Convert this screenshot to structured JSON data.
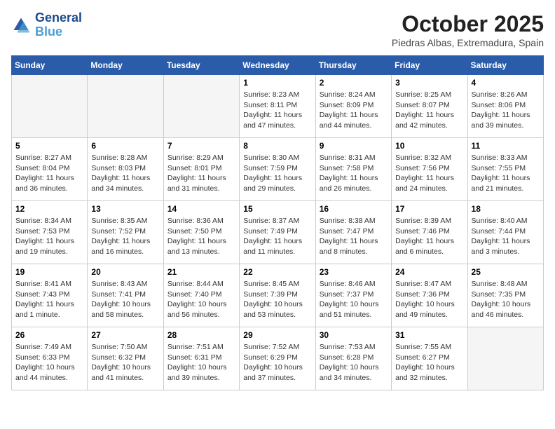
{
  "header": {
    "logo_line1": "General",
    "logo_line2": "Blue",
    "month_title": "October 2025",
    "location": "Piedras Albas, Extremadura, Spain"
  },
  "weekdays": [
    "Sunday",
    "Monday",
    "Tuesday",
    "Wednesday",
    "Thursday",
    "Friday",
    "Saturday"
  ],
  "weeks": [
    [
      {
        "day": "",
        "info": ""
      },
      {
        "day": "",
        "info": ""
      },
      {
        "day": "",
        "info": ""
      },
      {
        "day": "1",
        "info": "Sunrise: 8:23 AM\nSunset: 8:11 PM\nDaylight: 11 hours\nand 47 minutes."
      },
      {
        "day": "2",
        "info": "Sunrise: 8:24 AM\nSunset: 8:09 PM\nDaylight: 11 hours\nand 44 minutes."
      },
      {
        "day": "3",
        "info": "Sunrise: 8:25 AM\nSunset: 8:07 PM\nDaylight: 11 hours\nand 42 minutes."
      },
      {
        "day": "4",
        "info": "Sunrise: 8:26 AM\nSunset: 8:06 PM\nDaylight: 11 hours\nand 39 minutes."
      }
    ],
    [
      {
        "day": "5",
        "info": "Sunrise: 8:27 AM\nSunset: 8:04 PM\nDaylight: 11 hours\nand 36 minutes."
      },
      {
        "day": "6",
        "info": "Sunrise: 8:28 AM\nSunset: 8:03 PM\nDaylight: 11 hours\nand 34 minutes."
      },
      {
        "day": "7",
        "info": "Sunrise: 8:29 AM\nSunset: 8:01 PM\nDaylight: 11 hours\nand 31 minutes."
      },
      {
        "day": "8",
        "info": "Sunrise: 8:30 AM\nSunset: 7:59 PM\nDaylight: 11 hours\nand 29 minutes."
      },
      {
        "day": "9",
        "info": "Sunrise: 8:31 AM\nSunset: 7:58 PM\nDaylight: 11 hours\nand 26 minutes."
      },
      {
        "day": "10",
        "info": "Sunrise: 8:32 AM\nSunset: 7:56 PM\nDaylight: 11 hours\nand 24 minutes."
      },
      {
        "day": "11",
        "info": "Sunrise: 8:33 AM\nSunset: 7:55 PM\nDaylight: 11 hours\nand 21 minutes."
      }
    ],
    [
      {
        "day": "12",
        "info": "Sunrise: 8:34 AM\nSunset: 7:53 PM\nDaylight: 11 hours\nand 19 minutes."
      },
      {
        "day": "13",
        "info": "Sunrise: 8:35 AM\nSunset: 7:52 PM\nDaylight: 11 hours\nand 16 minutes."
      },
      {
        "day": "14",
        "info": "Sunrise: 8:36 AM\nSunset: 7:50 PM\nDaylight: 11 hours\nand 13 minutes."
      },
      {
        "day": "15",
        "info": "Sunrise: 8:37 AM\nSunset: 7:49 PM\nDaylight: 11 hours\nand 11 minutes."
      },
      {
        "day": "16",
        "info": "Sunrise: 8:38 AM\nSunset: 7:47 PM\nDaylight: 11 hours\nand 8 minutes."
      },
      {
        "day": "17",
        "info": "Sunrise: 8:39 AM\nSunset: 7:46 PM\nDaylight: 11 hours\nand 6 minutes."
      },
      {
        "day": "18",
        "info": "Sunrise: 8:40 AM\nSunset: 7:44 PM\nDaylight: 11 hours\nand 3 minutes."
      }
    ],
    [
      {
        "day": "19",
        "info": "Sunrise: 8:41 AM\nSunset: 7:43 PM\nDaylight: 11 hours\nand 1 minute."
      },
      {
        "day": "20",
        "info": "Sunrise: 8:43 AM\nSunset: 7:41 PM\nDaylight: 10 hours\nand 58 minutes."
      },
      {
        "day": "21",
        "info": "Sunrise: 8:44 AM\nSunset: 7:40 PM\nDaylight: 10 hours\nand 56 minutes."
      },
      {
        "day": "22",
        "info": "Sunrise: 8:45 AM\nSunset: 7:39 PM\nDaylight: 10 hours\nand 53 minutes."
      },
      {
        "day": "23",
        "info": "Sunrise: 8:46 AM\nSunset: 7:37 PM\nDaylight: 10 hours\nand 51 minutes."
      },
      {
        "day": "24",
        "info": "Sunrise: 8:47 AM\nSunset: 7:36 PM\nDaylight: 10 hours\nand 49 minutes."
      },
      {
        "day": "25",
        "info": "Sunrise: 8:48 AM\nSunset: 7:35 PM\nDaylight: 10 hours\nand 46 minutes."
      }
    ],
    [
      {
        "day": "26",
        "info": "Sunrise: 7:49 AM\nSunset: 6:33 PM\nDaylight: 10 hours\nand 44 minutes."
      },
      {
        "day": "27",
        "info": "Sunrise: 7:50 AM\nSunset: 6:32 PM\nDaylight: 10 hours\nand 41 minutes."
      },
      {
        "day": "28",
        "info": "Sunrise: 7:51 AM\nSunset: 6:31 PM\nDaylight: 10 hours\nand 39 minutes."
      },
      {
        "day": "29",
        "info": "Sunrise: 7:52 AM\nSunset: 6:29 PM\nDaylight: 10 hours\nand 37 minutes."
      },
      {
        "day": "30",
        "info": "Sunrise: 7:53 AM\nSunset: 6:28 PM\nDaylight: 10 hours\nand 34 minutes."
      },
      {
        "day": "31",
        "info": "Sunrise: 7:55 AM\nSunset: 6:27 PM\nDaylight: 10 hours\nand 32 minutes."
      },
      {
        "day": "",
        "info": ""
      }
    ]
  ]
}
